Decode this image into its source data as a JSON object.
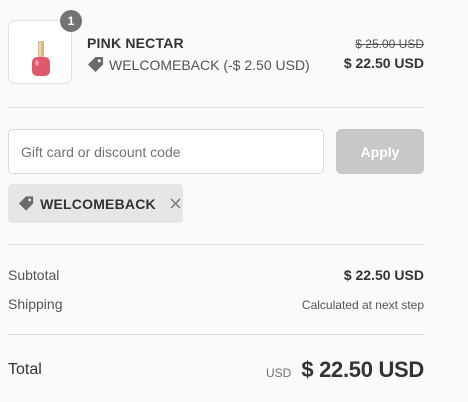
{
  "colors": {
    "text": "#333333",
    "muted": "#545454",
    "apply_button_bg": "#c8c8c8",
    "chip_bg": "#e6e6e6",
    "badge_bg": "#737373",
    "bottle_color": "#e0596a"
  },
  "product": {
    "quantity": "1",
    "name": "PINK NECTAR",
    "discount_line": "WELCOMEBACK (-$ 2.50 USD)",
    "original_price": "$ 25.00 USD",
    "final_price": "$ 22.50 USD",
    "thumbnail_icon": "nail-polish-bottle",
    "discount_icon": "tag-icon"
  },
  "discount": {
    "placeholder": "Gift card or discount code",
    "value": "",
    "apply_label": "Apply",
    "applied_code": "WELCOMEBACK",
    "chip_icon": "tag-icon",
    "remove_icon": "close-icon"
  },
  "summary": {
    "subtotal_label": "Subtotal",
    "subtotal_value": "$ 22.50 USD",
    "shipping_label": "Shipping",
    "shipping_value": "Calculated at next step"
  },
  "total": {
    "label": "Total",
    "currency": "USD",
    "amount": "$ 22.50 USD"
  }
}
